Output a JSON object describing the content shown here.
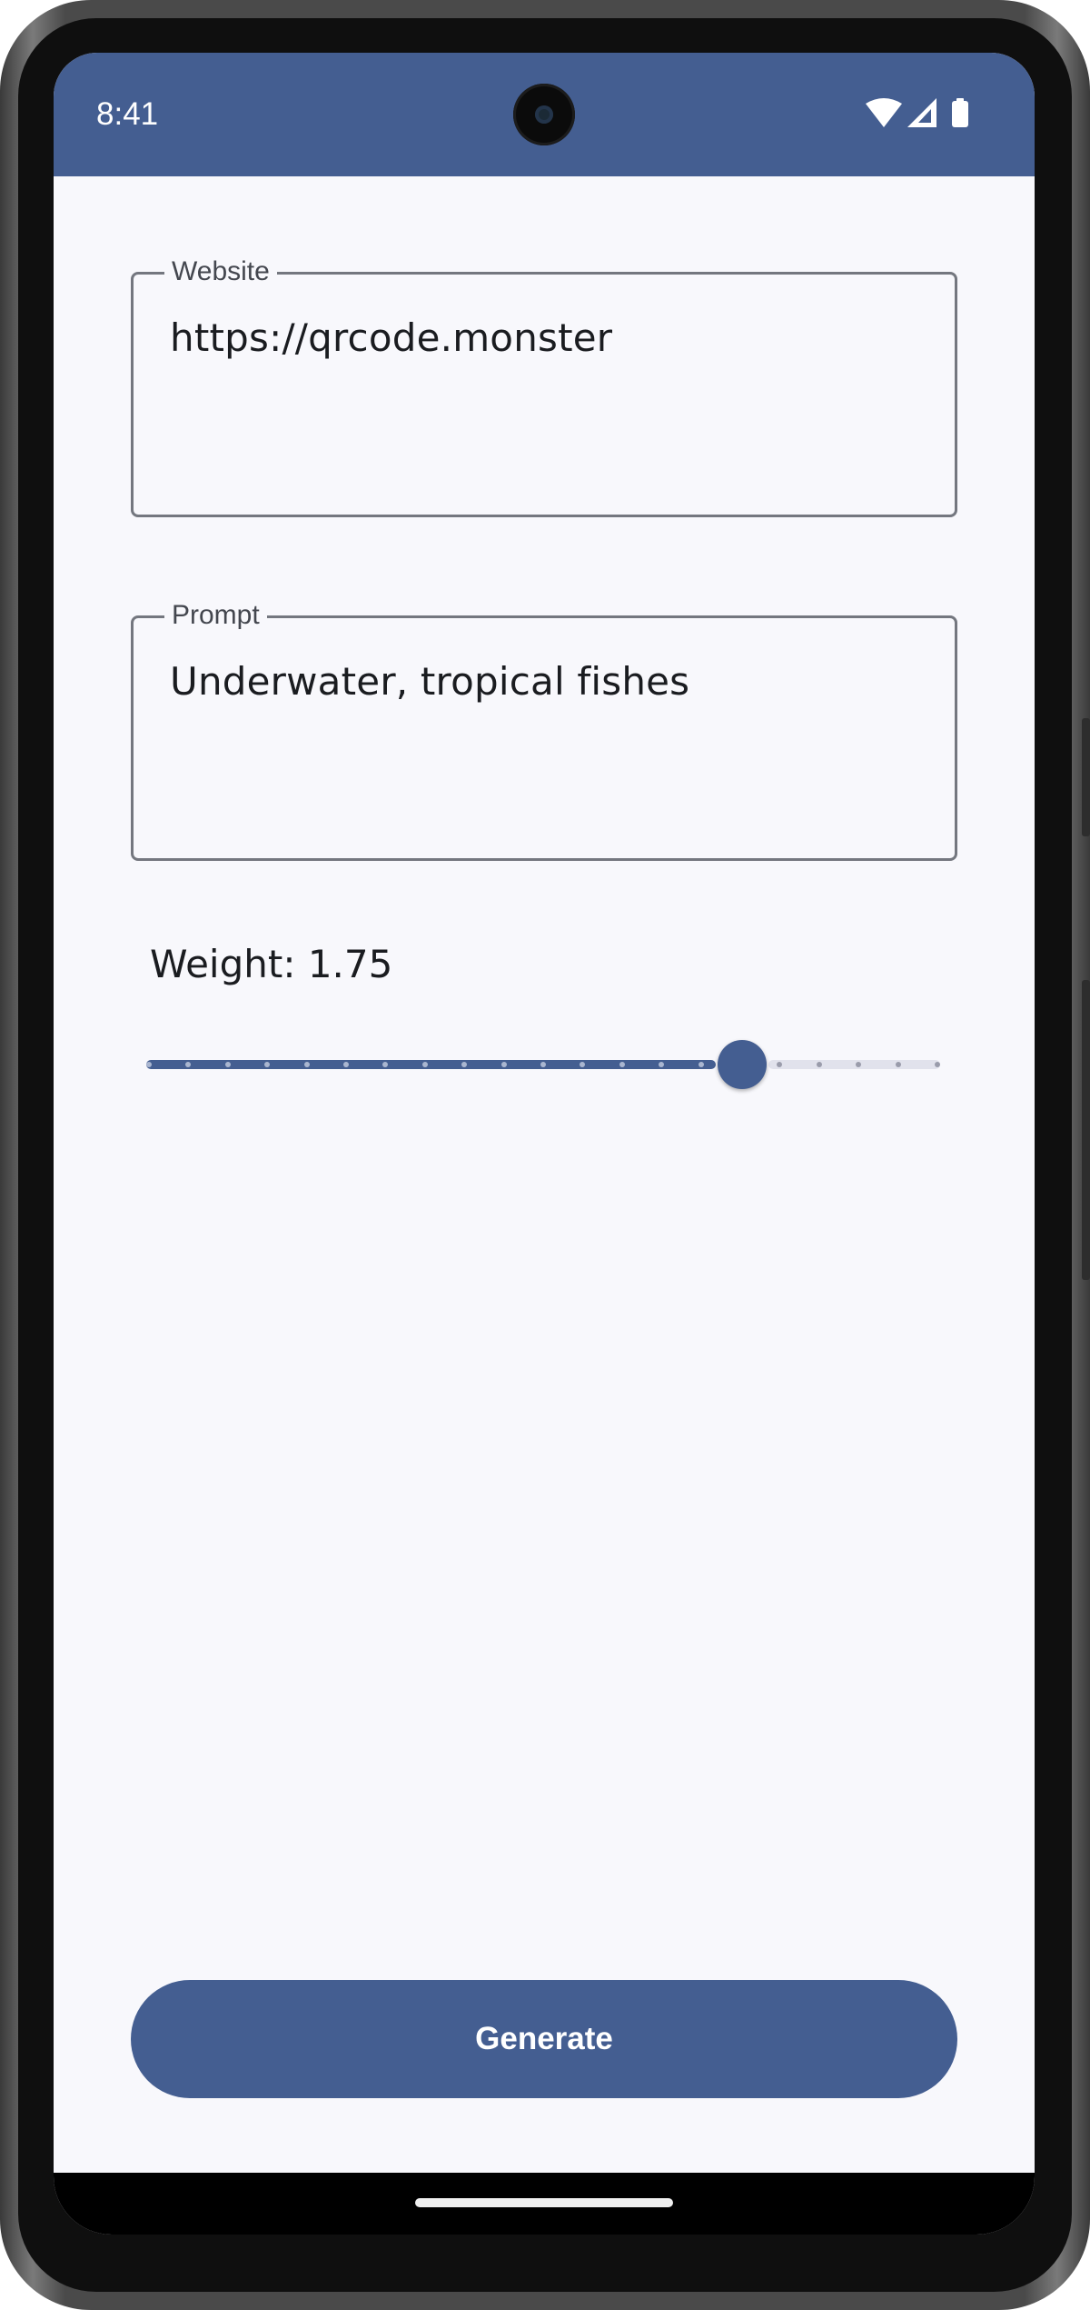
{
  "status_bar": {
    "time": "8:41",
    "icons": [
      "wifi-icon",
      "cellular-signal-icon",
      "battery-icon"
    ],
    "background_color": "#445e91"
  },
  "form": {
    "website": {
      "label": "Website",
      "value": "https://qrcode.monster"
    },
    "prompt": {
      "label": "Prompt",
      "value": "Underwater, tropical fishes"
    },
    "weight": {
      "label": "Weight: 1.75",
      "value": 1.75,
      "fraction": 0.75,
      "steps": 21
    }
  },
  "generate_button": {
    "label": "Generate"
  },
  "colors": {
    "primary": "#445e91",
    "surface": "#f8f8fc",
    "outline": "#74777f",
    "track_inactive": "#e1e2ec"
  }
}
